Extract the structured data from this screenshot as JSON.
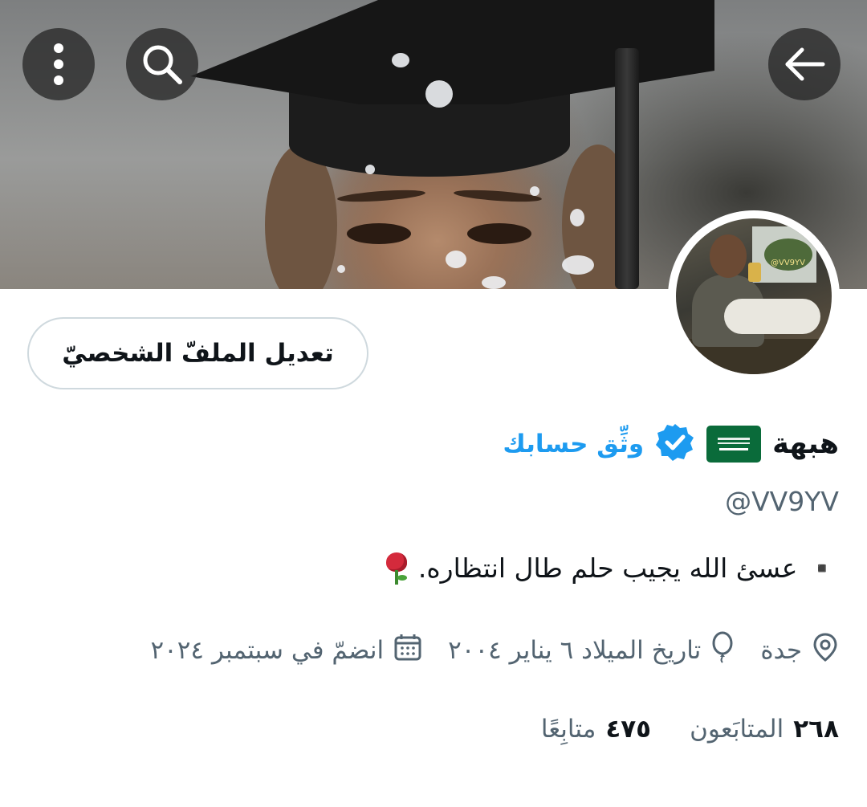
{
  "header": {
    "back_icon": "arrow-left-icon",
    "search_icon": "search-icon",
    "more_icon": "more-vertical-icon"
  },
  "avatar": {
    "overlay_text": "@VV9YV"
  },
  "profile": {
    "edit_button_label": "تعديل الملفّ الشخصيّ",
    "display_name": "هبهة",
    "flag": "saudi-arabia-flag",
    "verify_link": "وثِّق حسابك",
    "handle": "@VV9YV",
    "bio": "▪️ عسئ الله يجيب حلم طال انتظاره."
  },
  "meta": {
    "location": "جدة",
    "birthday": "تاريخ الميلاد ٦ يناير ٢٠٠٤",
    "joined": "انضمّ في سبتمبر ٢٠٢٤"
  },
  "stats": {
    "following_count": "٢٦٨",
    "following_label": "المتابَعون",
    "followers_count": "٤٧٥",
    "followers_label": "متابِعًا"
  },
  "colors": {
    "accent": "#1d9bf0",
    "secondary_text": "#536471",
    "primary_text": "#0f1419",
    "border": "#cfd9de"
  }
}
